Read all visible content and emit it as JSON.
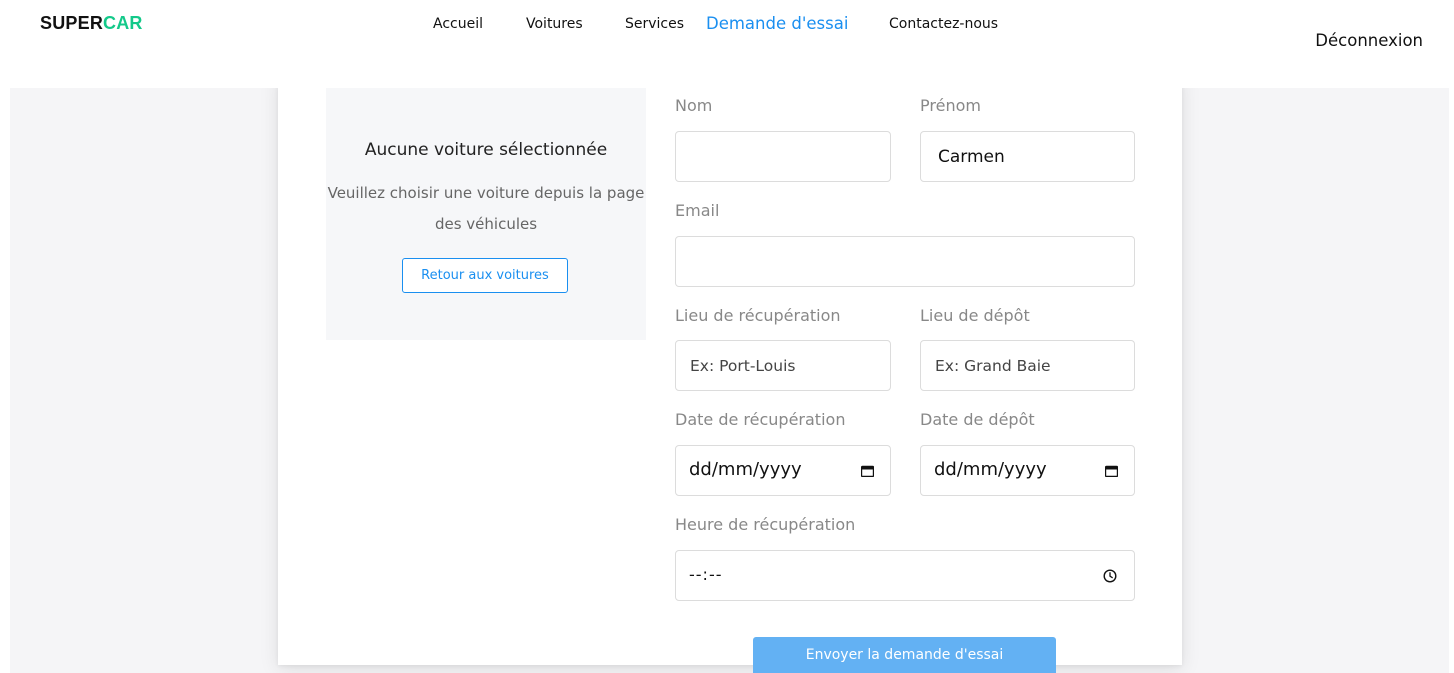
{
  "header": {
    "logo_part1": "SUPER",
    "logo_part2": "CAR",
    "nav": [
      {
        "label": "Accueil",
        "active": false
      },
      {
        "label": "Voitures",
        "active": false
      },
      {
        "label": "Services",
        "active": false
      },
      {
        "label": "Demande d'essai",
        "active": true
      },
      {
        "label": "Contactez-nous",
        "active": false
      }
    ],
    "logout_label": "Déconnexion"
  },
  "colors": {
    "brand_accent": "#14c98a",
    "primary": "#1a8ff0",
    "submit_bg": "#63b1f3"
  },
  "empty_state": {
    "title": "Aucune voiture sélectionnée",
    "message": "Veuillez choisir une voiture depuis la page des véhicules",
    "button_label": "Retour aux voitures"
  },
  "form": {
    "nom": {
      "label": "Nom",
      "value": ""
    },
    "prenom": {
      "label": "Prénom",
      "value": "Carmen"
    },
    "email": {
      "label": "Email",
      "value": ""
    },
    "pickup_location": {
      "label": "Lieu de récupération",
      "placeholder": "Ex: Port-Louis"
    },
    "dropoff_location": {
      "label": "Lieu de dépôt",
      "placeholder": "Ex: Grand Baie"
    },
    "pickup_date": {
      "label": "Date de récupération",
      "display": "dd/mm/yyyy",
      "icon": "calendar-icon"
    },
    "dropoff_date": {
      "label": "Date de dépôt",
      "display": "dd/mm/yyyy",
      "icon": "calendar-icon"
    },
    "pickup_time": {
      "label": "Heure de récupération",
      "display": "--:--",
      "icon": "clock-icon"
    },
    "submit_label": "Envoyer la demande d'essai"
  }
}
